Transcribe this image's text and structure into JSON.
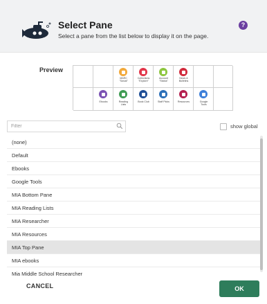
{
  "header": {
    "title": "Select Pane",
    "subtitle": "Select a pane from the list below to display it on the page.",
    "help_icon": "?"
  },
  "preview": {
    "label": "Preview",
    "top_tiles": [
      {
        "caption": "MARC\n\"Swoal\"",
        "color": "#f2a93b",
        "icon": "magnify-icon"
      },
      {
        "caption": "Collections\n\"Explore\"",
        "color": "#e2364a",
        "icon": "collections-icon"
      },
      {
        "caption": "Account\n\"Status\"",
        "color": "#8dc63f",
        "icon": "account-icon"
      },
      {
        "caption": "News &\nBulletins",
        "color": "#d12b3c",
        "icon": "news-icon"
      }
    ],
    "bottom_tiles": [
      {
        "caption": "Ebooks",
        "color": "#7b52b3",
        "icon": "ebook-icon"
      },
      {
        "caption": "Reading\nLists",
        "color": "#3f9b53",
        "icon": "reading-list-icon"
      },
      {
        "caption": "Book Club",
        "color": "#1f4e96",
        "icon": "book-club-icon"
      },
      {
        "caption": "Staff Picks",
        "color": "#2b6fb8",
        "icon": "staff-picks-icon"
      },
      {
        "caption": "Resources",
        "color": "#b5204f",
        "icon": "resources-icon"
      },
      {
        "caption": "Google\nTools",
        "color": "#3d7fd9",
        "icon": "google-tools-icon"
      }
    ]
  },
  "filter": {
    "placeholder": "Filter",
    "value": ""
  },
  "show_global": {
    "label": "show global",
    "checked": false
  },
  "list": {
    "items": [
      "(none)",
      "Default",
      "Ebooks",
      "Google Tools",
      "MIA Bottom Pane",
      "MIA Reading Lists",
      "MIA Researcher",
      "MIA Resources",
      "MIA Top Pane",
      "MIA ebooks",
      "Mia Middle School Researcher"
    ],
    "selected_index": 8
  },
  "footer": {
    "cancel_label": "CANCEL",
    "ok_label": "OK"
  },
  "colors": {
    "accent": "#2e7d5b",
    "help": "#6b3fa0",
    "header_bg": "#f1f2f3"
  }
}
